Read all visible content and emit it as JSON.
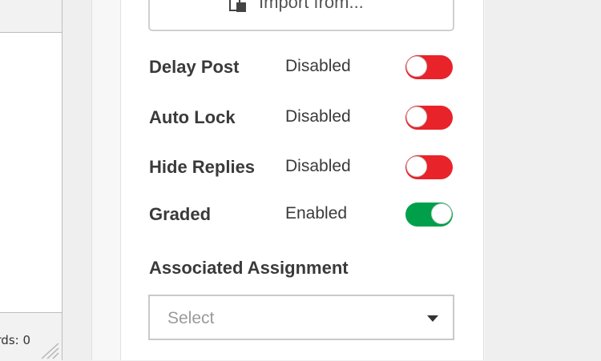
{
  "editor": {
    "word_count_text": "rds: 0"
  },
  "import_button": {
    "label": "Import from...",
    "icon": "import-icon"
  },
  "settings": [
    {
      "label": "Delay Post",
      "value": "Disabled",
      "enabled": false
    },
    {
      "label": "Auto Lock",
      "value": "Disabled",
      "enabled": false
    },
    {
      "label": "Hide Replies",
      "value": "Disabled",
      "enabled": false
    },
    {
      "label": "Graded",
      "value": "Enabled",
      "enabled": true
    }
  ],
  "associated_assignment": {
    "label": "Associated Assignment",
    "selected": "Select",
    "icon": "caret-down-icon"
  },
  "colors": {
    "toggle_off": "#e8232a",
    "toggle_on": "#00a04a",
    "text": "#3a3a3a",
    "placeholder": "#9a9a9a"
  }
}
